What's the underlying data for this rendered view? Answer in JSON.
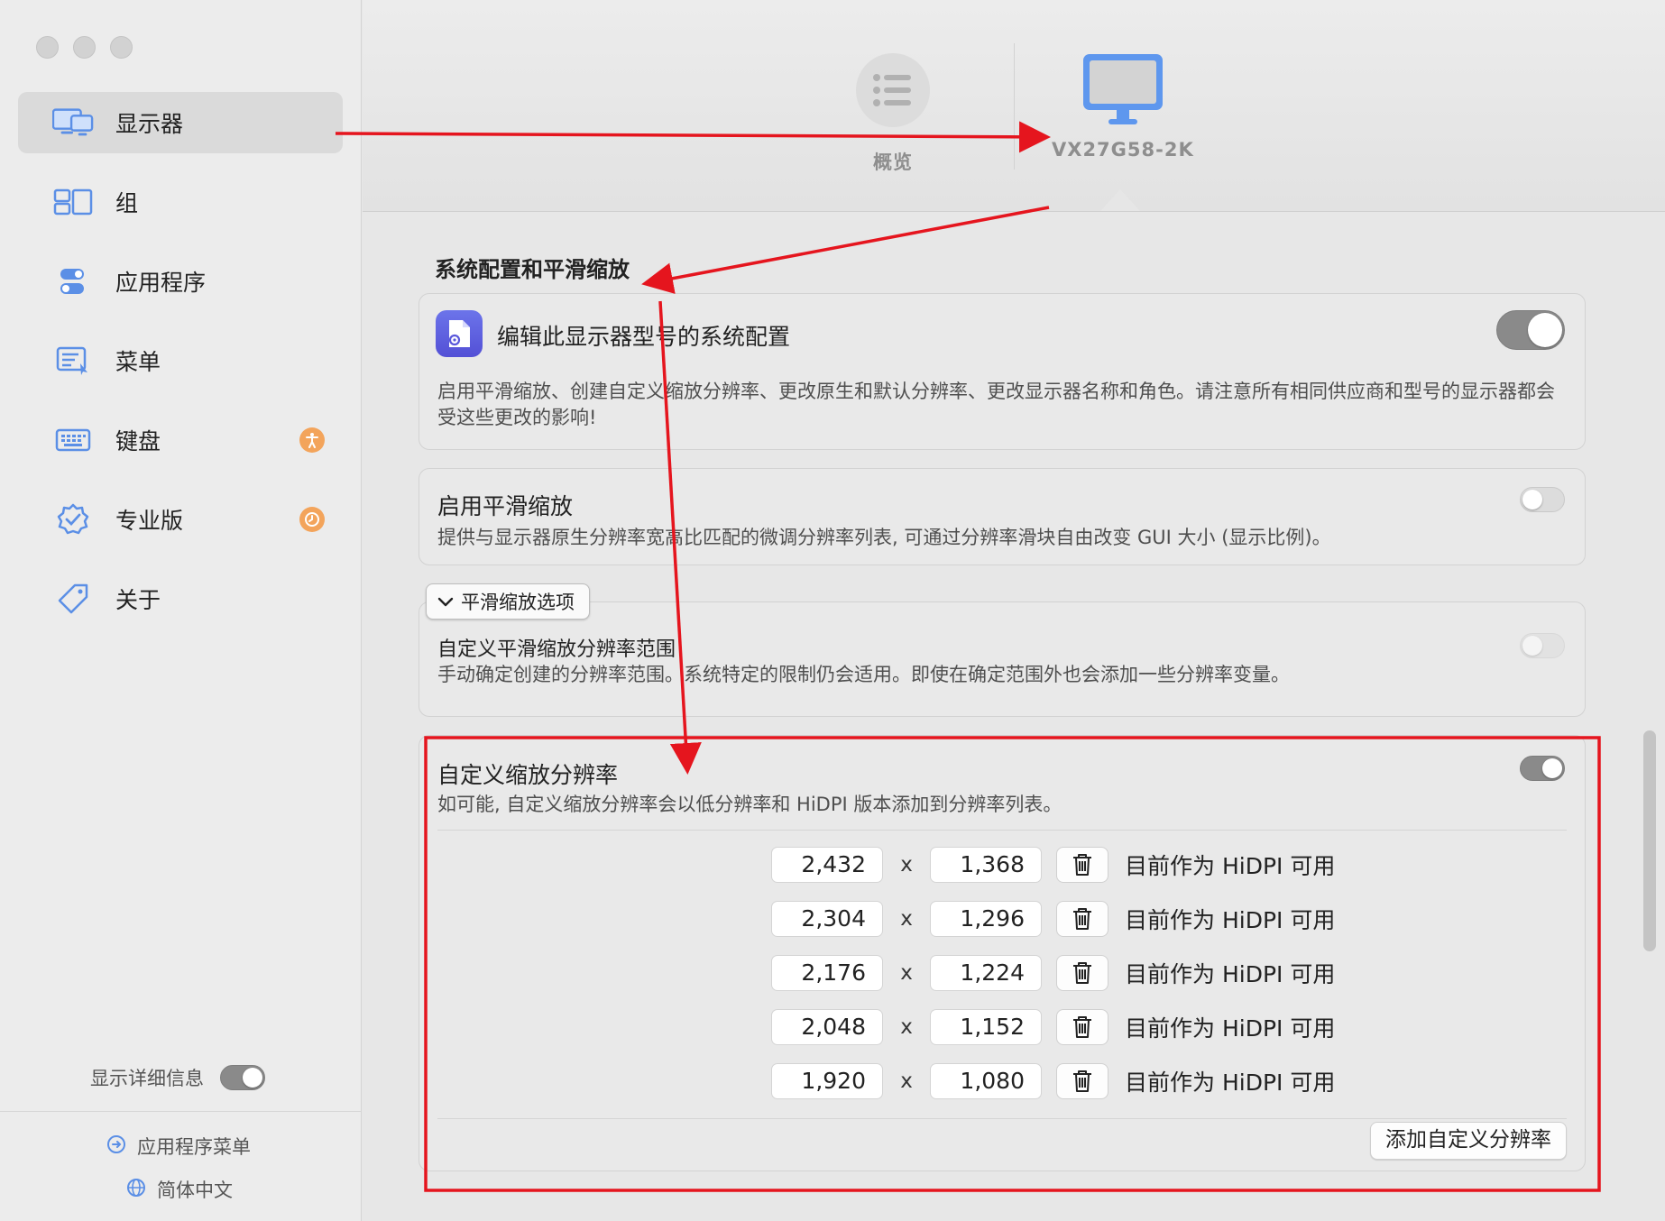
{
  "sidebar": {
    "items": [
      {
        "label": "显示器",
        "icon": "display-icon"
      },
      {
        "label": "组",
        "icon": "group-icon"
      },
      {
        "label": "应用程序",
        "icon": "apps-icon"
      },
      {
        "label": "菜单",
        "icon": "menu-icon"
      },
      {
        "label": "键盘",
        "icon": "keyboard-icon",
        "badge_icon": "accessibility-icon"
      },
      {
        "label": "专业版",
        "icon": "pro-badge-icon",
        "badge_icon": "clock-icon"
      },
      {
        "label": "关于",
        "icon": "tag-icon"
      }
    ],
    "details_label": "显示详细信息",
    "app_menu_label": "应用程序菜单",
    "language_label": "简体中文",
    "badge_color": "#f3a45b"
  },
  "header": {
    "overview_label": "概览",
    "display_label": "VX27G58-2K",
    "display_color": "#7aa7f0"
  },
  "content": {
    "section_title": "系统配置和平滑缩放",
    "system_config": {
      "title": "编辑此显示器型号的系统配置",
      "desc": "启用平滑缩放、创建自定义缩放分辨率、更改原生和默认分辨率、更改显示器名称和角色。请注意所有相同供应商和型号的显示器都会受这些更改的影响!",
      "enabled": true
    },
    "smooth_scaling": {
      "title": "启用平滑缩放",
      "desc": "提供与显示器原生分辨率宽高比匹配的微调分辨率列表, 可通过分辨率滑块自由改变 GUI 大小 (显示比例)。",
      "enabled": false
    },
    "options_label": "平滑缩放选项",
    "range": {
      "title": "自定义平滑缩放分辨率范围",
      "desc": "手动确定创建的分辨率范围。系统特定的限制仍会适用。即使在确定范围外也会添加一些分辨率变量。",
      "enabled": false
    },
    "custom": {
      "title": "自定义缩放分辨率",
      "desc": "如可能, 自定义缩放分辨率会以低分辨率和 HiDPI 版本添加到分辨率列表。",
      "enabled": true,
      "separator": "x",
      "rows": [
        {
          "w": "2,432",
          "h": "1,368",
          "status": "目前作为 HiDPI 可用"
        },
        {
          "w": "2,304",
          "h": "1,296",
          "status": "目前作为 HiDPI 可用"
        },
        {
          "w": "2,176",
          "h": "1,224",
          "status": "目前作为 HiDPI 可用"
        },
        {
          "w": "2,048",
          "h": "1,152",
          "status": "目前作为 HiDPI 可用"
        },
        {
          "w": "1,920",
          "h": "1,080",
          "status": "目前作为 HiDPI 可用"
        }
      ],
      "add_label": "添加自定义分辨率"
    }
  },
  "annotation_color": "#e5151e"
}
